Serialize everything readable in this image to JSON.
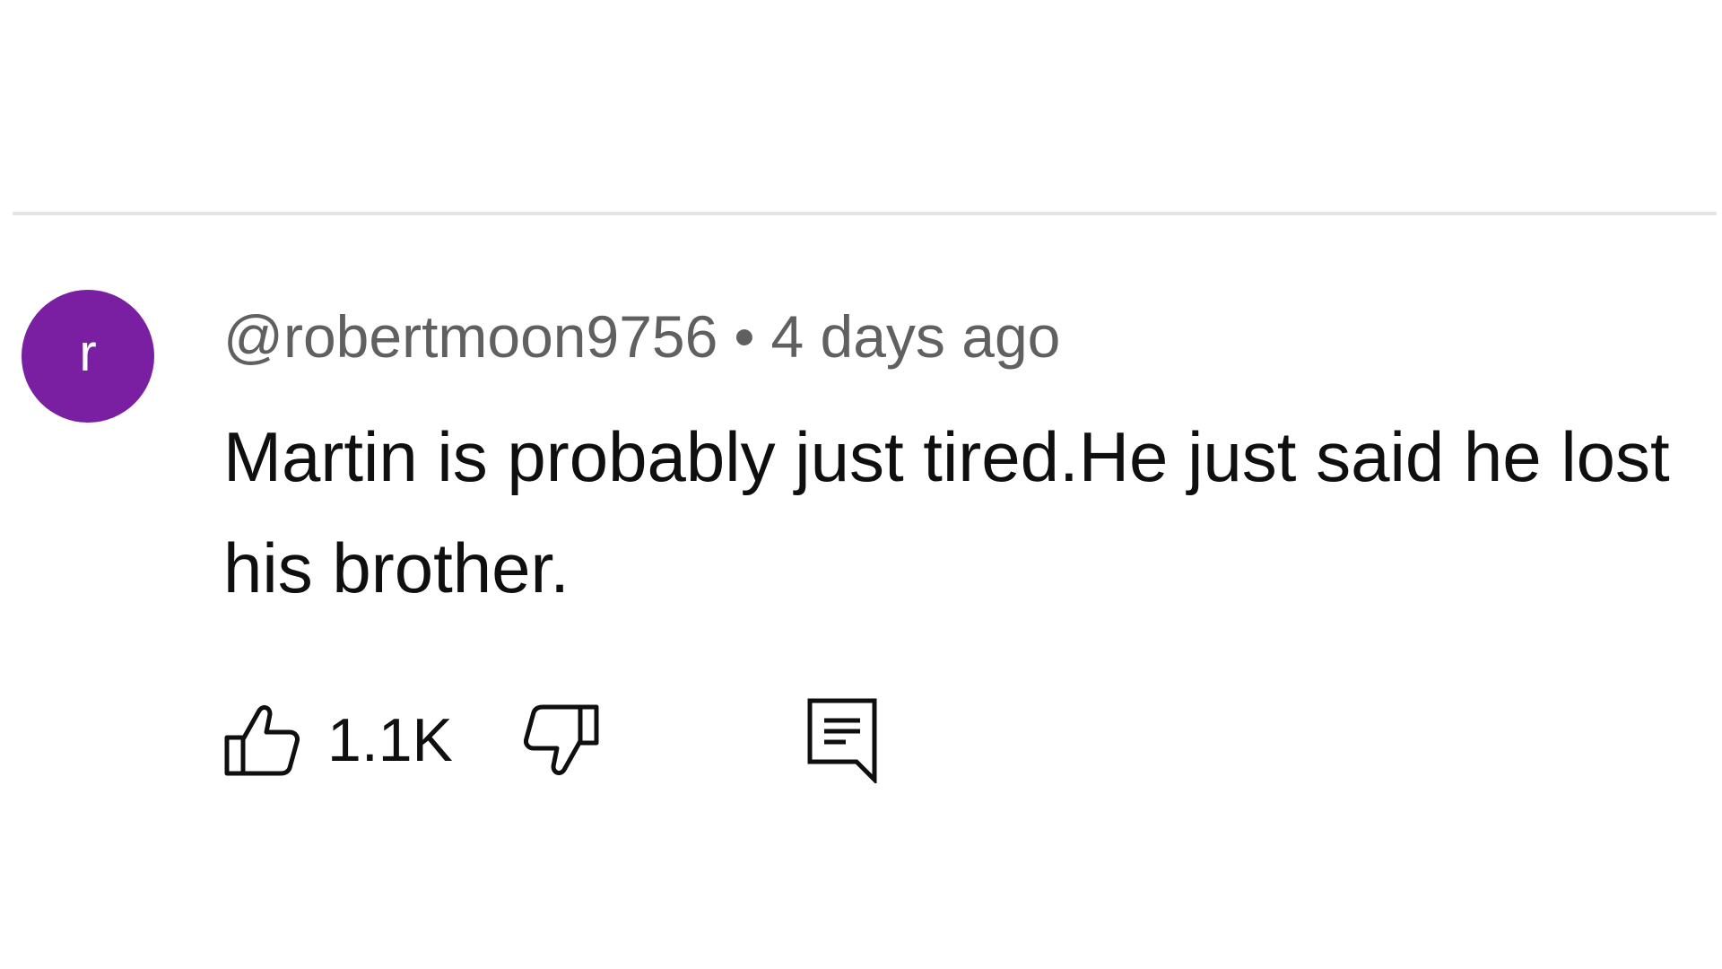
{
  "comment": {
    "avatar_letter": "r",
    "avatar_color": "#7b1fa2",
    "author": "@robertmoon9756",
    "separator": "•",
    "time_ago": "4 days ago",
    "text": "Martin is probably just tired.He just said he lost his brother.",
    "like_count": "1.1K"
  },
  "icons": {
    "like": "thumbs-up-icon",
    "dislike": "thumbs-down-icon",
    "reply": "reply-comment-icon"
  }
}
